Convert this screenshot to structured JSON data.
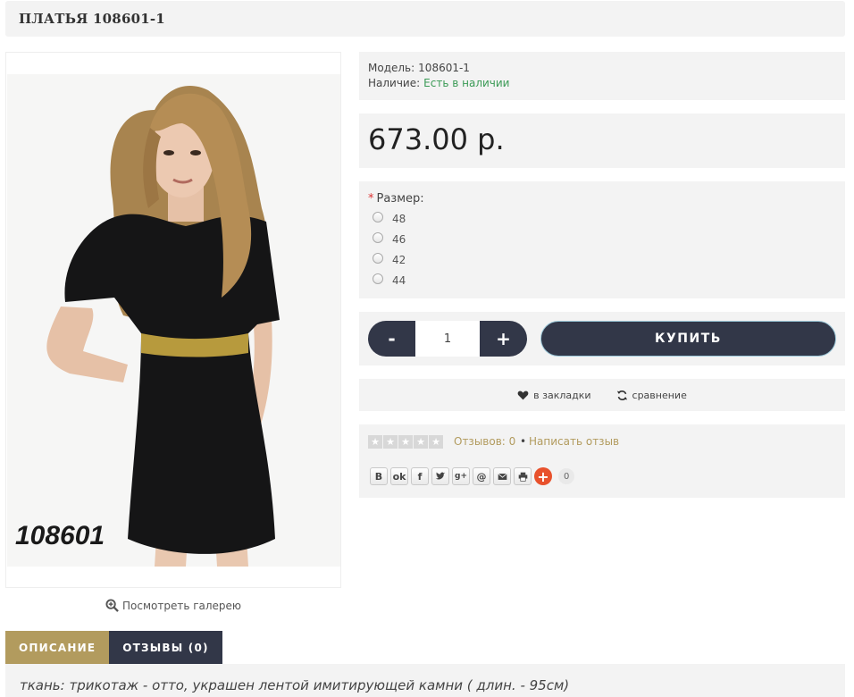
{
  "product": {
    "title": "ПЛАТЬЯ 108601-1",
    "image_code": "108601",
    "gallery_link": "Посмотреть галерею",
    "model_label": "Модель:",
    "model_value": "108601-1",
    "stock_label": "Наличие:",
    "stock_value": "Есть в наличии",
    "price": "673.00 р."
  },
  "options": {
    "required_mark": "*",
    "size_label": "Размер:",
    "sizes": [
      "48",
      "46",
      "42",
      "44"
    ]
  },
  "buy": {
    "minus": "-",
    "plus": "+",
    "quantity": "1",
    "buy_label": "КУПИТЬ"
  },
  "actions": {
    "wishlist": "в закладки",
    "compare": "сравнение"
  },
  "reviews": {
    "rating": 0,
    "count_text": "Отзывов: 0",
    "separator": "•",
    "write": "Написать отзыв"
  },
  "share": {
    "buttons": [
      "B",
      "ok",
      "f",
      "twitter",
      "g+",
      "@",
      "mail",
      "print"
    ],
    "count": "0"
  },
  "tabs": [
    {
      "label": "ОПИСАНИЕ",
      "active": true
    },
    {
      "label": "ОТЗЫВЫ (0)",
      "active": false
    }
  ],
  "description": "ткань: трикотаж - отто, украшен лентой имитирующей камни ( длин. - 95см)",
  "colors": {
    "accent": "#b29b5e",
    "dark": "#323748",
    "stock_green": "#3a9a55",
    "panel": "#f3f3f3"
  }
}
